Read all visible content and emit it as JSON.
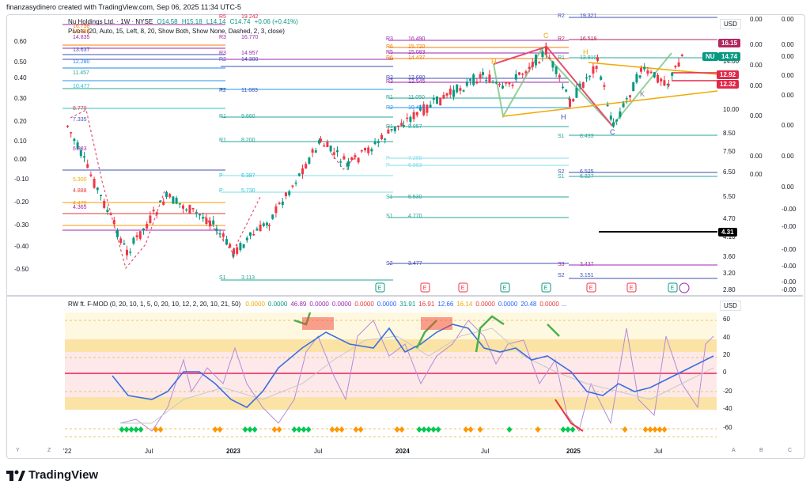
{
  "header": "finanzasydinero created with TradingView.com, Sep 06, 2025 11:34 UTC-5",
  "legend": {
    "symbol": "Nu Holdings Ltd. · 1W · NYSE",
    "o": "O14.58",
    "h": "H15.18",
    "l": "L14.14",
    "c": "C14.74",
    "change": "+0.06 (+0.41%)",
    "pivots": "Pivots (20, Auto, 15, Left, 8, 20, Show Both, Show None, Dashed, 2, 3, close)"
  },
  "indicator_legend": {
    "name": "RW ft. F-MOD (0, 20, 10, 1, 5, 0, 20, 10, 12, 2, 20, 10, 21, 50)",
    "values": [
      "0.0000",
      "0.0000",
      "46.89",
      "0.0000",
      "0.0000",
      "0.0000",
      "0.0000",
      "31.91",
      "16.91",
      "12.66",
      "16.14",
      "0.0000",
      "0.0000",
      "20.48",
      "0.0000"
    ],
    "value_colors": [
      "#f2a900",
      "#089981",
      "#9c27b0",
      "#9c27b0",
      "#9c27b0",
      "#e53935",
      "#2962ff",
      "#089981",
      "#e53935",
      "#2962ff",
      "#f2a900",
      "#e53935",
      "#2962ff",
      "#2962ff",
      "#e53935"
    ],
    "ellipsis": "..."
  },
  "left_axis": [
    "0.60",
    "0.50",
    "0.40",
    "0.30",
    "0.20",
    "0.10",
    "0.00",
    "-0.10",
    "-0.20",
    "-0.30",
    "-0.40",
    "-0.50"
  ],
  "left_axis2": [
    "0.00",
    "0.00",
    "0.00",
    "0.00",
    "0.00",
    "0.00",
    "0.00",
    "0.00",
    "-0.00",
    "-0.00",
    "-0.00",
    "-0.00",
    "-0.00",
    "-0.00",
    "-0.00"
  ],
  "right_axis": [
    "0.00",
    "0.00",
    "0.00",
    "0.00",
    "0.00",
    "0.00",
    "0.00",
    "0.00",
    "-0.00",
    "-0.00",
    "-0.00",
    "-0.00",
    "-0.00",
    "-0.00",
    "-0.00"
  ],
  "price_axis": [
    "USD",
    "14.00",
    "10.00",
    "8.50",
    "7.50",
    "6.50",
    "5.50",
    "4.70",
    "4.10",
    "3.60",
    "3.20",
    "2.80"
  ],
  "price_tags": [
    {
      "text": "16.15",
      "color": "#b2275f"
    },
    {
      "text": "NU",
      "color": "#089981"
    },
    {
      "text": "14.74",
      "color": "#089981"
    },
    {
      "text": "12.92",
      "color": "#e0294a"
    },
    {
      "text": "12.32",
      "color": "#e0294a"
    },
    {
      "text": "4.31",
      "color": "#000000"
    }
  ],
  "indicator_axis": [
    "USD",
    "60",
    "40",
    "20",
    "0",
    "-20",
    "-40",
    "-60"
  ],
  "time_axis": [
    "'22",
    "Jul",
    "2023",
    "Jul",
    "2024",
    "Jul",
    "2025",
    "Jul"
  ],
  "corner": {
    "y": "Y",
    "z": "Z",
    "a": "A",
    "b": "B",
    "c": "C"
  },
  "brand": "TradingView",
  "pivot_labels": [
    {
      "t": "R5",
      "v": "19.242"
    },
    {
      "t": "R3",
      "v": "16.770"
    },
    {
      "t": "R3",
      "v": "14.957"
    },
    {
      "t": "R2",
      "v": "14.300"
    },
    {
      "t": "R2",
      "v": "11.683"
    },
    {
      "t": "R1",
      "v": "9.660"
    },
    {
      "t": "R1",
      "v": "8.200"
    },
    {
      "t": "P",
      "v": "6.387"
    },
    {
      "t": "P",
      "v": "5.730"
    },
    {
      "t": "S1",
      "v": "3.113"
    },
    {
      "t": "R3",
      "v": "16.490"
    },
    {
      "t": "R6",
      "v": "15.720"
    },
    {
      "t": "R5",
      "v": "15.083"
    },
    {
      "t": "R6",
      "v": "14.437"
    },
    {
      "t": "R2",
      "v": "12.680"
    },
    {
      "t": "R3",
      "v": "12.545"
    },
    {
      "t": "R1",
      "v": "11.050"
    },
    {
      "t": "R2",
      "v": "10.450"
    },
    {
      "t": "R1",
      "v": "8.957"
    },
    {
      "t": "P",
      "v": "7.200"
    },
    {
      "t": "P",
      "v": "6.863"
    },
    {
      "t": "S1",
      "v": "5.530"
    },
    {
      "t": "S1",
      "v": "4.770"
    },
    {
      "t": "S2",
      "v": "3.477"
    },
    {
      "t": "R2",
      "v": "19.321"
    },
    {
      "t": "R2",
      "v": "16.518"
    },
    {
      "t": "R1",
      "v": "13.810"
    },
    {
      "t": "S1",
      "v": "8.433"
    },
    {
      "t": "S2",
      "v": "6.525"
    },
    {
      "t": "S1",
      "v": "6.327"
    },
    {
      "t": "S3",
      "v": "3.437"
    },
    {
      "t": "S2",
      "v": "3.151"
    }
  ],
  "left_levels": [
    "16.758",
    "15.338",
    "14.835",
    "13.637",
    "12.280",
    "11.457",
    "10.477",
    "8.770",
    "7.335",
    "6.883",
    "5.300",
    "4.888",
    "4.470",
    "4.365"
  ],
  "pattern_labels": {
    "h1": "H",
    "c1": "C",
    "h2": "H",
    "h3": "H",
    "c2": "C",
    "k": "K"
  },
  "earnings_marker": "E",
  "colors": {
    "up": "#089981",
    "down": "#f23645",
    "pivot_red": "#e0294a",
    "pivot_blue": "#3f51b5",
    "zigzag": "#e05070"
  }
}
